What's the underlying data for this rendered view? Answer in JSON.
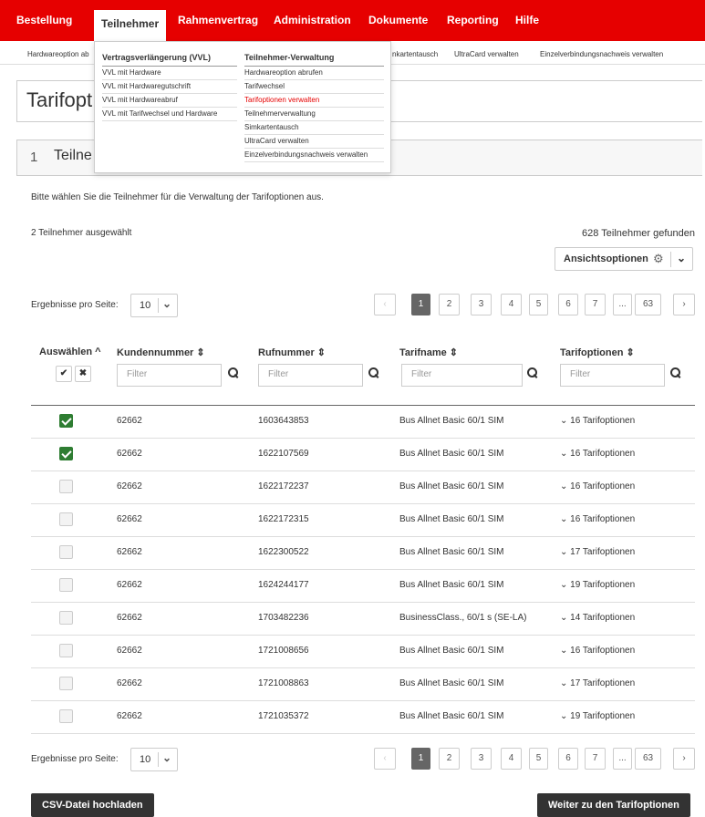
{
  "topnav": {
    "items": [
      {
        "label": "Bestellung",
        "active": false
      },
      {
        "label": "Teilnehmer",
        "active": true
      },
      {
        "label": "Rahmenvertrag",
        "active": false
      },
      {
        "label": "Administration",
        "active": false
      },
      {
        "label": "Dokumente",
        "active": false
      },
      {
        "label": "Reporting",
        "active": false
      },
      {
        "label": "Hilfe",
        "active": false
      }
    ]
  },
  "subnav": {
    "items": [
      "Hardwareoption ab",
      "nkartentausch",
      "UltraCard verwalten",
      "Einzelverbindungsnachweis verwalten"
    ]
  },
  "dropdown": {
    "col1": {
      "heading": "Vertragsverlängerung (VVL)",
      "links": [
        "VVL mit Hardware",
        "VVL mit Hardwaregutschrift",
        "VVL mit Hardwareabruf",
        "VVL mit Tarifwechsel und Hardware"
      ]
    },
    "col2": {
      "heading": "Teilnehmer-Verwaltung",
      "links": [
        "Hardwareoption abrufen",
        "Tarifwechsel",
        "Tarifoptionen verwalten",
        "Teilnehmerverwaltung",
        "Simkartentausch",
        "UltraCard verwalten",
        "Einzelverbindungsnachweis verwalten"
      ]
    }
  },
  "page": {
    "title": "Tarifopt",
    "section_number": "1",
    "section_title": "Teilne",
    "instruction": "Bitte wählen Sie die Teilnehmer für die Verwaltung der Tarifoptionen aus.",
    "selected_count": "2 Teilnehmer ausgewählt",
    "found_count": "628 Teilnehmer gefunden",
    "view_options_label": "Ansichtsoptionen"
  },
  "pagination": {
    "per_page_label": "Ergebnisse pro Seite:",
    "per_page_value": "10",
    "pages": [
      "1",
      "2",
      "3",
      "4",
      "5",
      "6",
      "7",
      "...",
      "63"
    ],
    "current_page": "1",
    "prev_symbol": "‹",
    "next_symbol": "›"
  },
  "table": {
    "headers": {
      "select": "Auswählen ^",
      "kundennummer": "Kundennummer ⇕",
      "rufnummer": "Rufnummer ⇕",
      "tarifname": "Tarifname ⇕",
      "tarifoptionen": "Tarifoptionen ⇕"
    },
    "select_all_symbol": "✔",
    "deselect_all_symbol": "✖",
    "filter_placeholder": "Filter",
    "rows": [
      {
        "checked": true,
        "kundennummer": "62662",
        "rufnummer": "1603643853",
        "tarifname": "Bus Allnet Basic 60/1 SIM",
        "tarifoptionen": "⌄ 16 Tarifoptionen"
      },
      {
        "checked": true,
        "kundennummer": "62662",
        "rufnummer": "1622107569",
        "tarifname": "Bus Allnet Basic 60/1 SIM",
        "tarifoptionen": "⌄ 16 Tarifoptionen"
      },
      {
        "checked": false,
        "kundennummer": "62662",
        "rufnummer": "1622172237",
        "tarifname": "Bus Allnet Basic 60/1 SIM",
        "tarifoptionen": "⌄ 16 Tarifoptionen"
      },
      {
        "checked": false,
        "kundennummer": "62662",
        "rufnummer": "1622172315",
        "tarifname": "Bus Allnet Basic 60/1 SIM",
        "tarifoptionen": "⌄ 16 Tarifoptionen"
      },
      {
        "checked": false,
        "kundennummer": "62662",
        "rufnummer": "1622300522",
        "tarifname": "Bus Allnet Basic 60/1 SIM",
        "tarifoptionen": "⌄ 17 Tarifoptionen"
      },
      {
        "checked": false,
        "kundennummer": "62662",
        "rufnummer": "1624244177",
        "tarifname": "Bus Allnet Basic 60/1 SIM",
        "tarifoptionen": "⌄ 19 Tarifoptionen"
      },
      {
        "checked": false,
        "kundennummer": "62662",
        "rufnummer": "1703482236",
        "tarifname": "BusinessClass., 60/1 s (SE-LA)",
        "tarifoptionen": "⌄ 14 Tarifoptionen"
      },
      {
        "checked": false,
        "kundennummer": "62662",
        "rufnummer": "1721008656",
        "tarifname": "Bus Allnet Basic 60/1 SIM",
        "tarifoptionen": "⌄ 16 Tarifoptionen"
      },
      {
        "checked": false,
        "kundennummer": "62662",
        "rufnummer": "1721008863",
        "tarifname": "Bus Allnet Basic 60/1 SIM",
        "tarifoptionen": "⌄ 17 Tarifoptionen"
      },
      {
        "checked": false,
        "kundennummer": "62662",
        "rufnummer": "1721035372",
        "tarifname": "Bus Allnet Basic 60/1 SIM",
        "tarifoptionen": "⌄ 19 Tarifoptionen"
      }
    ]
  },
  "buttons": {
    "csv_upload": "CSV-Datei hochladen",
    "next": "Weiter zu den Tarifoptionen"
  },
  "icons": {
    "gear": "⚙",
    "chevron_down": "⌄"
  },
  "colors": {
    "brand_red": "#e60000",
    "checkbox_green": "#2e7d32",
    "active_page": "#666666",
    "dark_button": "#333333"
  }
}
